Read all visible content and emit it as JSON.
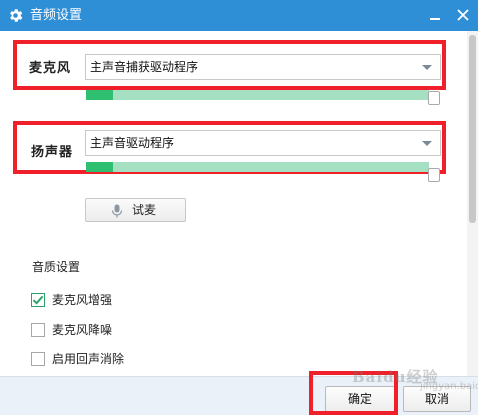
{
  "window": {
    "title": "音频设置",
    "icon": "gear-icon"
  },
  "microphone": {
    "label": "麦克风",
    "selected": "主声音捕获驱动程序",
    "level": 0.08
  },
  "speaker": {
    "label": "扬声器",
    "selected": "主声音驱动程序",
    "level": 0.08
  },
  "test_button": {
    "label": "试麦",
    "icon": "microphone-icon"
  },
  "quality": {
    "title": "音质设置",
    "options": [
      {
        "label": "麦克风增强",
        "checked": true
      },
      {
        "label": "麦克风降噪",
        "checked": false
      },
      {
        "label": "启用回声消除",
        "checked": false
      }
    ]
  },
  "footer": {
    "ok_label": "确定",
    "cancel_label": "取消"
  },
  "watermark": {
    "text": "Baidu经验",
    "sub": "jingyan.baidu.com"
  },
  "colors": {
    "titlebar": "#2f8fd6",
    "highlight_box": "#f0202a",
    "meter_fill": "#2fbf71",
    "meter_track": "#a5e0c3"
  }
}
